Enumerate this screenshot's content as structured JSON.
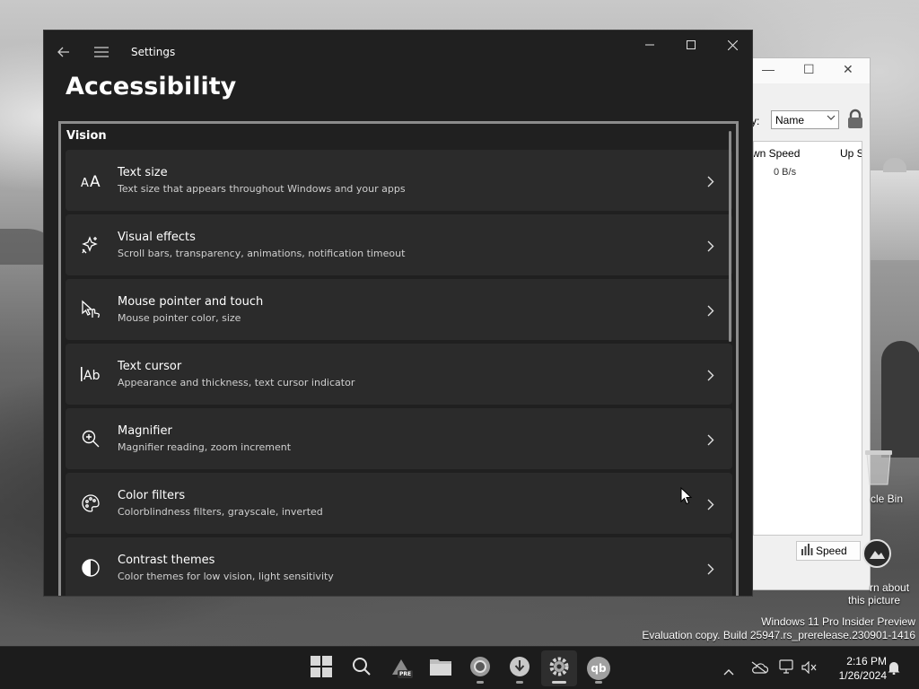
{
  "settings_window": {
    "app_title": "Settings",
    "page_title": "Accessibility",
    "section_title": "Vision",
    "items": [
      {
        "label": "Text size",
        "description": "Text size that appears throughout Windows and your apps",
        "icon": "text-size-icon"
      },
      {
        "label": "Visual effects",
        "description": "Scroll bars, transparency, animations, notification timeout",
        "icon": "sparkle-icon"
      },
      {
        "label": "Mouse pointer and touch",
        "description": "Mouse pointer color, size",
        "icon": "pointer-touch-icon"
      },
      {
        "label": "Text cursor",
        "description": "Appearance and thickness, text cursor indicator",
        "icon": "text-cursor-icon"
      },
      {
        "label": "Magnifier",
        "description": "Magnifier reading, zoom increment",
        "icon": "magnifier-icon"
      },
      {
        "label": "Color filters",
        "description": "Colorblindness filters, grayscale, inverted",
        "icon": "palette-icon"
      },
      {
        "label": "Contrast themes",
        "description": "Color themes for low vision, light sensitivity",
        "icon": "contrast-icon"
      }
    ]
  },
  "background_app": {
    "sort_label": "y:",
    "sort_value": "Name",
    "columns": [
      "wn Speed",
      "Up S"
    ],
    "down_speed_value": "0 B/s",
    "speed_button_label": "Speed"
  },
  "desktop": {
    "recycle_bin_label": "cle Bin",
    "learn_line1": "rn about",
    "learn_line2": "this picture",
    "watermark_line1": "Windows 11 Pro Insider Preview",
    "watermark_line2": "Evaluation copy. Build 25947.rs_prerelease.230901-1416"
  },
  "taskbar": {
    "pinned": [
      "windows-start-icon",
      "search-icon",
      "dev-pre-icon",
      "file-explorer-icon",
      "browser-icon",
      "installer-icon",
      "settings-icon",
      "qbittorrent-icon"
    ],
    "qb_text": "qb",
    "pre_badge": "PRE",
    "time": "2:16 PM",
    "date": "1/26/2024"
  }
}
